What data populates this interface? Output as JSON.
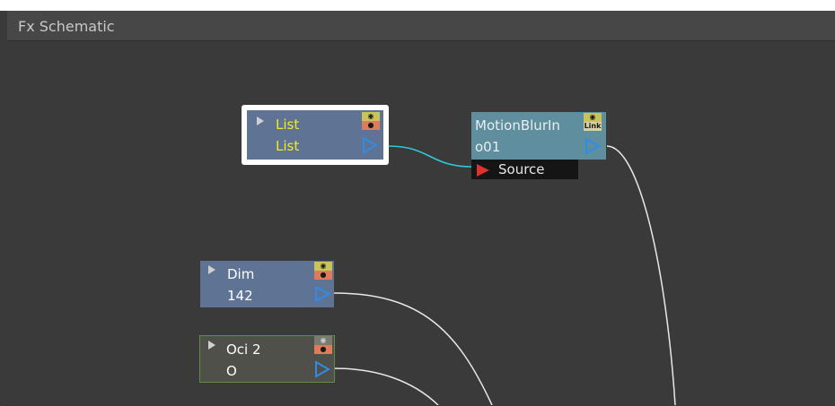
{
  "panel": {
    "title": "Fx Schematic"
  },
  "nodes": {
    "list": {
      "name": "List",
      "value": "List",
      "colors": {
        "body": "#5f7394",
        "text": "#f0ea28",
        "outline": "#ffffff"
      }
    },
    "motionblur": {
      "name": "MotionBlurIn",
      "value": "o01",
      "badge": "Link",
      "port_label": "Source",
      "colors": {
        "body": "#5f8e9e",
        "text": "#e8eef0"
      }
    },
    "dim": {
      "name": "Dim",
      "value": "142",
      "colors": {
        "body": "#5f7394",
        "text": "#ffffff"
      }
    },
    "oci": {
      "name": "Oci 2",
      "value": "O",
      "colors": {
        "body": "#4e5049",
        "text": "#ffffff",
        "outline": "#5f8a4a"
      }
    }
  },
  "icons": {
    "eye": "eye-icon",
    "render": "render-toggle-icon",
    "output_port": "output-port-arrow-icon",
    "input_port": "input-port-arrow-icon",
    "expand": "expand-triangle-icon"
  },
  "colors": {
    "wire_selected": "#2ec8d8",
    "wire": "#e8e8e8",
    "canvas": "#3a3a3a"
  }
}
